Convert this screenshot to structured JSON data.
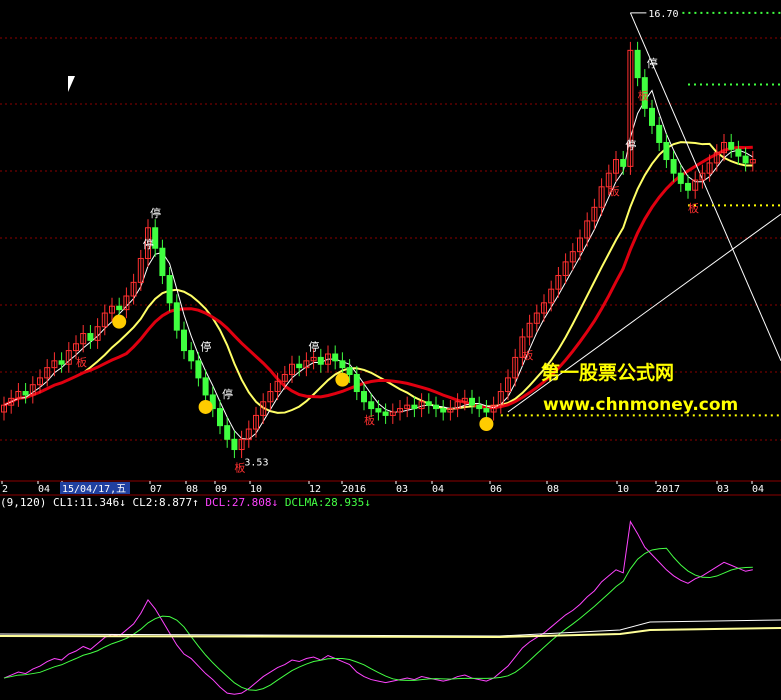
{
  "colors": {
    "background": "#000000",
    "grid": "#8b0000",
    "axis_text": "#ffffff",
    "up_candle": "#ff3030",
    "down_candle": "#00e0ff",
    "green_candle": "#40ff40",
    "ma_red": "#e00010",
    "ma_yellow": "#ffff66",
    "ma_white": "#ffffff",
    "osc_cl1": "#ffffff",
    "osc_cl2": "#ffff99",
    "osc_dcl": "#ff44ff",
    "osc_dclma": "#44ff44",
    "watermark": "#ffff00"
  },
  "watermark": {
    "cn": "第一股票公式网",
    "url": "www.chnmoney.com"
  },
  "chart_data": [
    {
      "type": "candlestick",
      "x_ticks": [
        "2",
        "04",
        "15/04/17,五",
        "07",
        "08",
        "09",
        "10",
        "12",
        "2016",
        "03",
        "04",
        "06",
        "08",
        "10",
        "2017",
        "03",
        "04"
      ],
      "highlighted_tick": "15/04/17,五",
      "annotations": {
        "high_label": "16.70",
        "low_label": "3.53",
        "limit_up": "停",
        "board": "板"
      },
      "grid": true,
      "close": [
        5.2,
        5.4,
        5.6,
        5.5,
        5.8,
        6.0,
        6.3,
        6.5,
        6.4,
        6.8,
        7.0,
        7.3,
        7.1,
        7.5,
        7.9,
        8.1,
        8.0,
        8.4,
        8.8,
        9.5,
        10.4,
        9.8,
        9.0,
        8.2,
        7.4,
        6.8,
        6.5,
        6.0,
        5.5,
        5.1,
        4.6,
        4.2,
        3.9,
        4.2,
        4.5,
        4.9,
        5.3,
        5.6,
        5.9,
        6.1,
        6.4,
        6.3,
        6.5,
        6.6,
        6.4,
        6.7,
        6.5,
        6.3,
        6.1,
        5.6,
        5.3,
        5.1,
        5.0,
        4.9,
        5.0,
        5.1,
        5.2,
        5.1,
        5.3,
        5.2,
        5.1,
        5.0,
        5.1,
        5.3,
        5.4,
        5.2,
        5.1,
        5.0,
        5.2,
        5.6,
        6.0,
        6.6,
        7.2,
        7.6,
        7.9,
        8.2,
        8.6,
        9.0,
        9.4,
        9.7,
        10.1,
        10.6,
        11.0,
        11.6,
        12.0,
        12.4,
        12.2,
        15.6,
        14.8,
        13.9,
        13.4,
        12.9,
        12.4,
        12.0,
        11.7,
        11.5,
        11.8,
        12.0,
        12.3,
        12.6,
        12.9,
        12.7,
        12.5,
        12.3,
        12.4
      ],
      "limit_up_days": [
        19,
        20,
        27,
        30,
        42,
        86,
        89
      ],
      "oscillator": {
        "params": "(9,120)",
        "series": [
          {
            "name": "CL1",
            "value": "11.346",
            "arrow": "↓"
          },
          {
            "name": "CL2",
            "value": "8.877",
            "arrow": "↑"
          },
          {
            "name": "DCL",
            "value": "27.808",
            "arrow": "↓"
          },
          {
            "name": "DCLMA",
            "value": "28.935",
            "arrow": "↓"
          }
        ]
      }
    }
  ]
}
